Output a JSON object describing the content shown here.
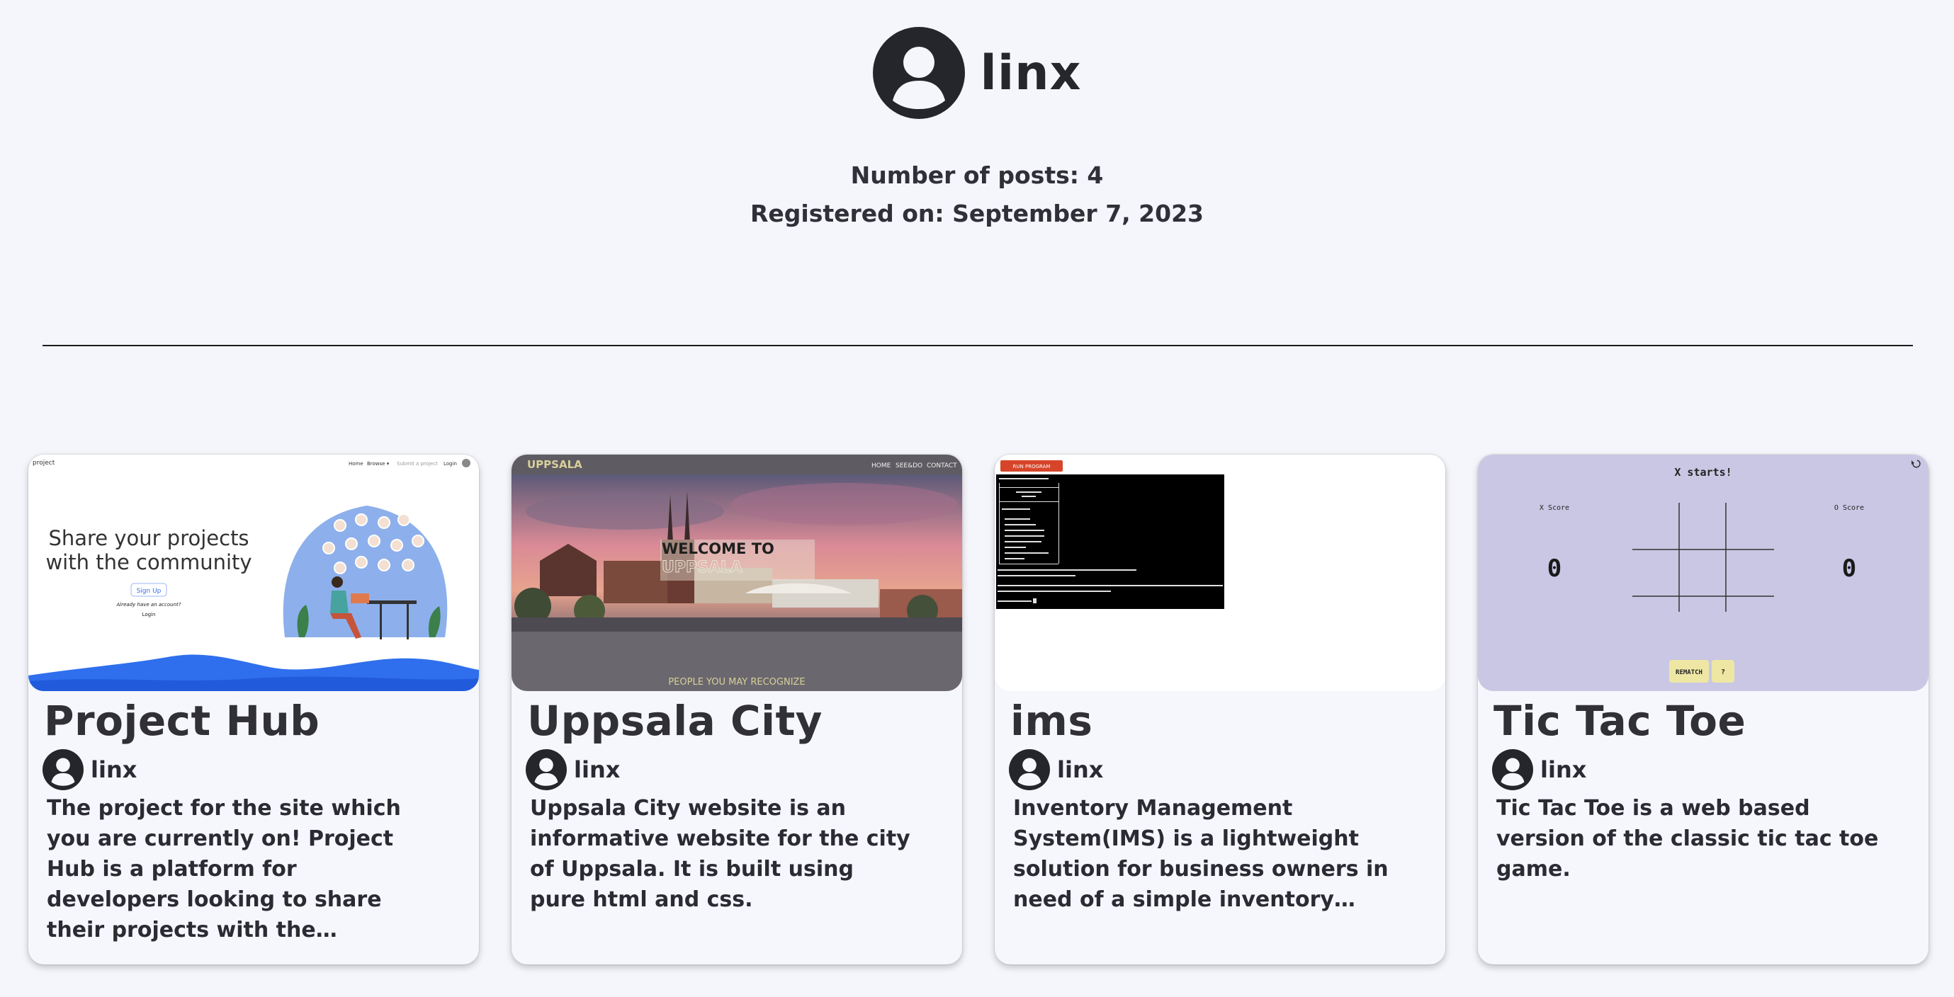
{
  "profile": {
    "username": "linx",
    "posts_label": "Number of posts: 4",
    "registered_label": "Registered on: September 7, 2023"
  },
  "projects": [
    {
      "title": "Project Hub",
      "author": "linx",
      "description": "The project for the site which you are currently on! Project Hub is a platform for developers looking to share their projects with the…",
      "thumbnail": {
        "logo": "project",
        "nav": [
          "Home",
          "Browse ▾",
          "Submit a project",
          "Login"
        ],
        "headline": "Share your projects with the community",
        "signup": "Sign Up",
        "already": "Already have an account?",
        "login": "Login"
      }
    },
    {
      "title": "Uppsala City",
      "author": "linx",
      "description": "Uppsala City website is an informative website for the city of Uppsala. It is built using pure html and css.",
      "thumbnail": {
        "logo": "UPPSALA",
        "nav": [
          "HOME",
          "SEE&DO",
          "CONTACT"
        ],
        "welcome": "WELCOME TO",
        "city": "UPPSALA",
        "footer": "PEOPLE YOU MAY RECOGNIZE"
      }
    },
    {
      "title": "ims",
      "author": "linx",
      "description": "Inventory Management System(IMS) is a lightweight solution for business owners in need of a simple inventory…",
      "thumbnail": {
        "run_button": "RUN PROGRAM"
      }
    },
    {
      "title": "Tic Tac Toe",
      "author": "linx",
      "description": "Tic Tac Toe is a web based version of the classic tic tac toe game.",
      "thumbnail": {
        "status": "X starts!",
        "x_label": "X Score",
        "o_label": "O Score",
        "x_score": "0",
        "o_score": "0",
        "rematch": "REMATCH",
        "help": "?"
      }
    }
  ],
  "colors": {
    "background": "#f5f6fb",
    "card": "#f6f7fc",
    "text": "#2a2b33",
    "tictactoe_bg": "#c9c7e3",
    "projecthub_wave": "#2f6fee"
  },
  "icons": [
    "user-avatar-icon",
    "refresh-icon"
  ]
}
